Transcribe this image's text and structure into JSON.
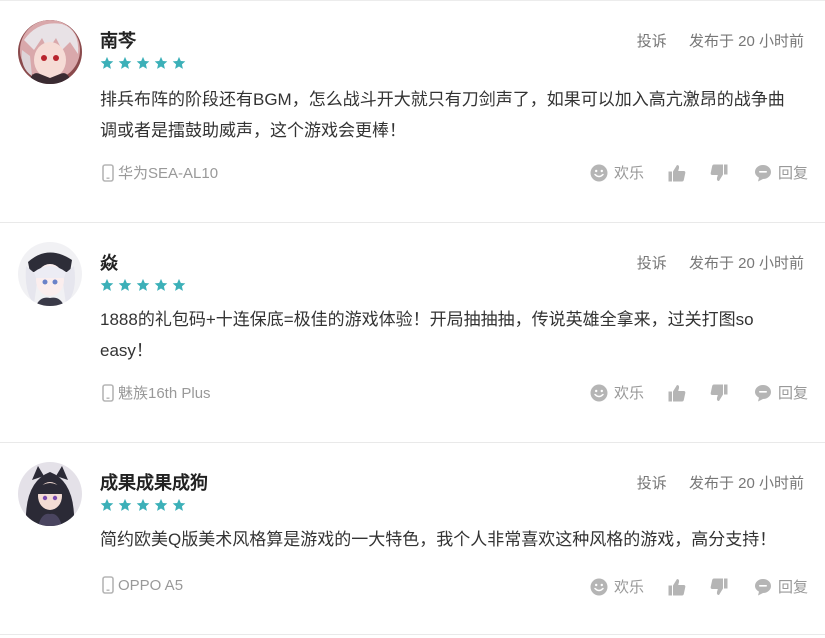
{
  "colors": {
    "star": "#3cb0b8",
    "icon": "#b5b5b5"
  },
  "reviews": [
    {
      "username": "南芩",
      "rating": 5,
      "report_label": "投诉",
      "time_label": "发布于 20 小时前",
      "content": "排兵布阵的阶段还有BGM，怎么战斗开大就只有刀剑声了，如果可以加入高亢激昂的战争曲调或者是擂鼓助威声，这个游戏会更棒！",
      "device": "华为SEA-AL10",
      "happy_label": "欢乐",
      "reply_label": "回复"
    },
    {
      "username": "焱",
      "rating": 5,
      "report_label": "投诉",
      "time_label": "发布于 20 小时前",
      "content": "1888的礼包码+十连保底=极佳的游戏体验！开局抽抽抽，传说英雄全拿来，过关打图so easy！",
      "device": "魅族16th Plus",
      "happy_label": "欢乐",
      "reply_label": "回复"
    },
    {
      "username": "成果成果成狗",
      "rating": 5,
      "report_label": "投诉",
      "time_label": "发布于 20 小时前",
      "content": "简约欧美Q版美术风格算是游戏的一大特色，我个人非常喜欢这种风格的游戏，高分支持！",
      "device": "OPPO A5",
      "happy_label": "欢乐",
      "reply_label": "回复"
    }
  ]
}
